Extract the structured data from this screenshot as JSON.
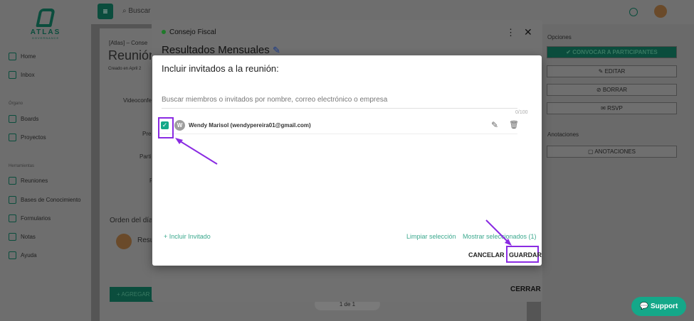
{
  "app": {
    "logo": "ATLAS",
    "logo_sub": "GOVERNANCE"
  },
  "topbar": {
    "search_placeholder": "Buscar"
  },
  "sidebar": {
    "items_main": [
      {
        "label": "Home"
      },
      {
        "label": "Inbox"
      }
    ],
    "section_organo": "Órgano",
    "items_organo": [
      {
        "label": "Boards"
      },
      {
        "label": "Proyectos"
      }
    ],
    "section_herr": "Herramientas",
    "items_herr": [
      {
        "label": "Reuniones"
      },
      {
        "label": "Bases de Conocimiento"
      },
      {
        "label": "Formularios"
      },
      {
        "label": "Notas"
      },
      {
        "label": "Ayuda"
      }
    ]
  },
  "background": {
    "breadcrumb": "[Atlas] – Conse",
    "page_title": "Reunión",
    "sub": "Creado en April 2",
    "fields": [
      "Videoconfer",
      "Pre",
      "Parti",
      "F"
    ],
    "agenda": "Orden del día",
    "agenda_item": "Resu",
    "add_button": "+ AGREGAR",
    "pager": "1 de 1"
  },
  "right_panel": {
    "options_title": "Opciones",
    "btn_convocar": "CONVOCAR A PARTICIPANTES",
    "btn_editar": "EDITAR",
    "btn_borrar": "BORRAR",
    "btn_rsvp": "RSVP",
    "annotations_title": "Anotaciones",
    "btn_anotaciones": "ANOTACIONES"
  },
  "meeting_modal": {
    "board": "Consejo Fiscal",
    "title": "Resultados Mensuales",
    "close_label": "CERRAR"
  },
  "dialog": {
    "title": "Incluir invitados a la reunión:",
    "search_placeholder": "Buscar miembros o invitados por nombre, correo electrónico o empresa",
    "counter": "0/100",
    "invitee": {
      "initial": "W",
      "name": "Wendy Marisol (wendypereira01@gmail.com)",
      "checked": true
    },
    "include_invite": "+ Incluir Invitado",
    "clear_selection": "Limpiar selección",
    "show_selected": "Mostrar seleccionados (1)",
    "cancel": "CANCELAR",
    "save": "GUARDAR"
  },
  "support": {
    "label": "Support"
  },
  "colors": {
    "accent": "#14a889",
    "brand_dark": "#0b4d3d",
    "highlight": "#8a2be2"
  }
}
